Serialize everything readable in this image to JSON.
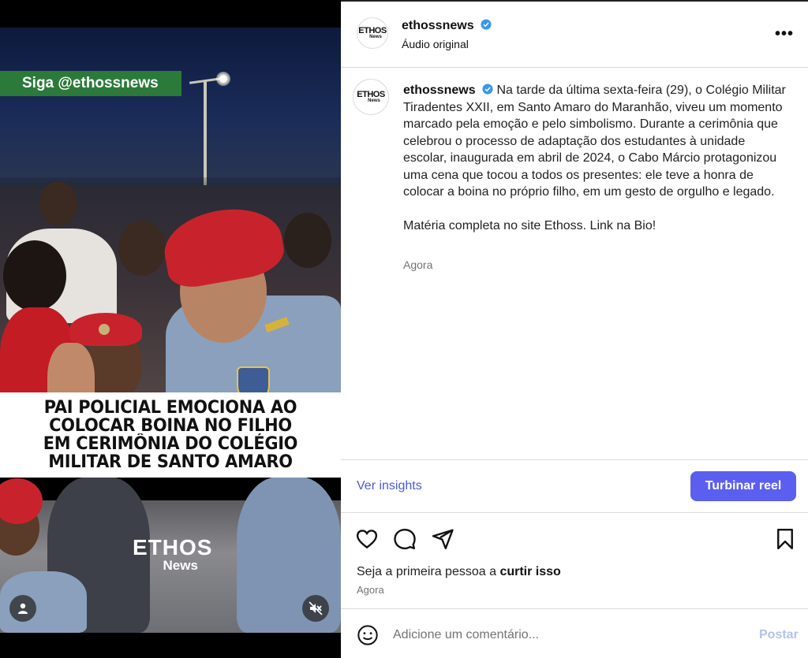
{
  "media": {
    "overlay_tag": "Siga @ethossnews",
    "headline_lines": [
      "PAI POLICIAL EMOCIONA AO",
      "COLOCAR BOINA NO FILHO",
      "EM CERIMÔNIA DO COLÉGIO",
      "MILITAR DE SANTO AMARO"
    ],
    "watermark_top": "ETHOS",
    "watermark_bottom": "News",
    "user_icon": "user-icon",
    "mute_icon": "muted-speaker-icon"
  },
  "header": {
    "avatar_line1": "ETHOS",
    "avatar_line2": "News",
    "username": "ethossnews",
    "audio": "Áudio original",
    "more": "•••"
  },
  "caption": {
    "username": "ethossnews",
    "text": "Na tarde da última sexta-feira (29), o Colégio Militar Tiradentes XXII, em Santo Amaro do Maranhão, viveu um momento marcado pela emoção e pelo simbolismo. Durante a cerimônia que celebrou o processo de adaptação dos estudantes à unidade escolar, inaugurada em abril de 2024, o Cabo Márcio protagonizou uma cena que tocou a todos os presentes: ele teve a honra de colocar a boina no próprio filho, em um gesto de orgulho e legado.",
    "text2": "Matéria completa no site Ethoss. Link na Bio!",
    "time": "Agora"
  },
  "insights": {
    "link": "Ver insights",
    "boost_button": "Turbinar reel"
  },
  "actions": {
    "likes_prefix": "Seja a primeira pessoa a ",
    "likes_link": "curtir isso",
    "time": "Agora"
  },
  "comment": {
    "placeholder": "Adicione um comentário...",
    "post_button": "Postar"
  },
  "colors": {
    "accent": "#5b5ff0",
    "link": "#4a5ad8",
    "verified": "#3897f0",
    "beret": "#c8232c",
    "overlay_green": "#2c7a3a"
  }
}
